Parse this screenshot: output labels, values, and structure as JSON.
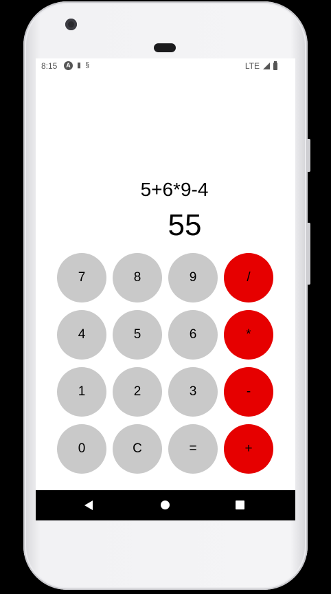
{
  "status_bar": {
    "time": "8:15",
    "left_icons": [
      "app-a-icon",
      "sd-card-icon",
      "sync-icon"
    ],
    "network": "LTE",
    "right_icons": [
      "signal-icon",
      "battery-icon"
    ]
  },
  "display": {
    "expression": "5+6*9-4",
    "result": "55"
  },
  "keypad": {
    "keys": [
      {
        "label": "7",
        "type": "digit"
      },
      {
        "label": "8",
        "type": "digit"
      },
      {
        "label": "9",
        "type": "digit"
      },
      {
        "label": "/",
        "type": "operator"
      },
      {
        "label": "4",
        "type": "digit"
      },
      {
        "label": "5",
        "type": "digit"
      },
      {
        "label": "6",
        "type": "digit"
      },
      {
        "label": "*",
        "type": "operator"
      },
      {
        "label": "1",
        "type": "digit"
      },
      {
        "label": "2",
        "type": "digit"
      },
      {
        "label": "3",
        "type": "digit"
      },
      {
        "label": "-",
        "type": "operator"
      },
      {
        "label": "0",
        "type": "digit"
      },
      {
        "label": "C",
        "type": "digit"
      },
      {
        "label": "=",
        "type": "digit"
      },
      {
        "label": "+",
        "type": "operator"
      }
    ]
  },
  "colors": {
    "digit_key": "#c9c9c9",
    "operator_key": "#e60000",
    "screen_background": "#ffffff",
    "nav_bar": "#000000"
  },
  "nav_bar": {
    "icons": [
      "back-icon",
      "home-icon",
      "recents-icon"
    ]
  }
}
